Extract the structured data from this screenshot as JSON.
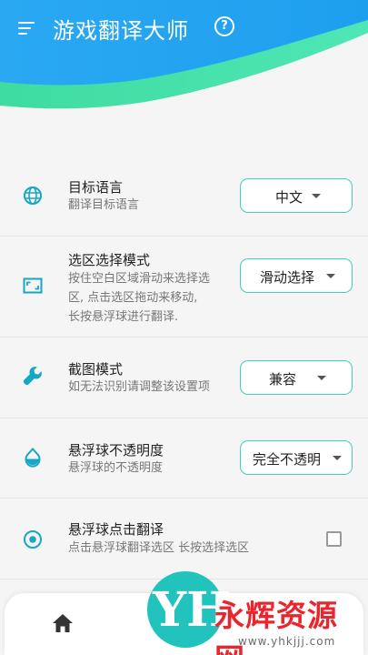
{
  "header": {
    "title": "游戏翻译大师",
    "help_symbol": "?",
    "gradient_colors": [
      "#27a9f3",
      "#1fa0ef"
    ],
    "wave_color": "#43e0a8"
  },
  "settings": {
    "target_language": {
      "title": "目标语言",
      "desc": "翻译目标语言",
      "value": "中文",
      "icon": "globe-icon"
    },
    "selection_mode": {
      "title": "选区选择模式",
      "desc_lines": [
        "按住空白区域滑动来选择选",
        "区, 点击选区拖动来移动,",
        "长按悬浮球进行翻译."
      ],
      "value": "滑动选择",
      "icon": "crop-frame-icon"
    },
    "screenshot_mode": {
      "title": "截图模式",
      "desc": "如无法识别请调整该设置项",
      "value": "兼容",
      "icon": "wrench-icon"
    },
    "ball_opacity": {
      "title": "悬浮球不透明度",
      "desc": "悬浮球的不透明度",
      "value": "完全不透明",
      "icon": "droplet-icon"
    },
    "ball_click_translate": {
      "title": "悬浮球点击翻译",
      "desc": "点击悬浮球翻译选区 长按选择选区",
      "checked": false,
      "icon": "radio-target-icon"
    }
  },
  "accent_color": "#21c3bc",
  "bottom_nav": {
    "home_icon": "home-icon"
  },
  "watermark": {
    "logo": "YH",
    "title": "永辉资源网",
    "url": "www.yhkjjj.com"
  }
}
